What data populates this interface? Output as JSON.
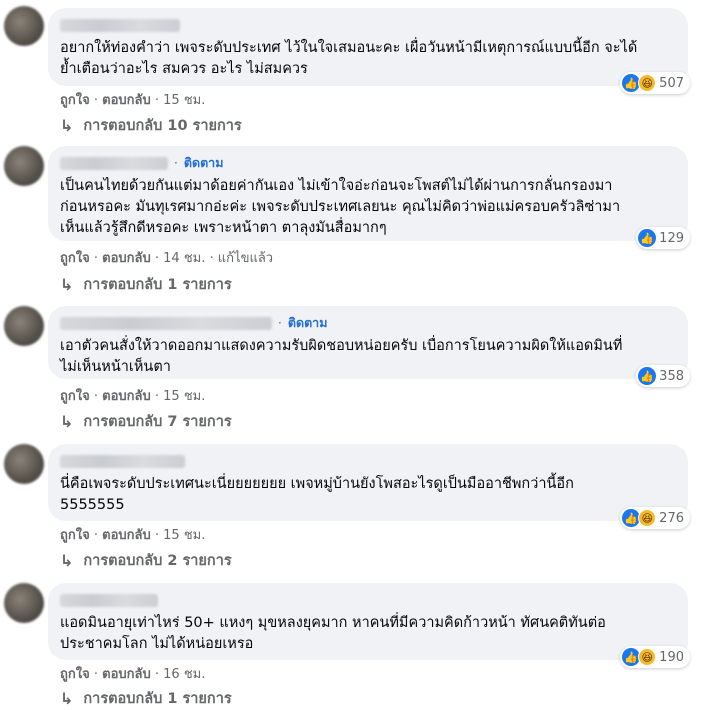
{
  "comments": [
    {
      "follow": "",
      "text": "อยากให้ท่องคำว่า เพจระดับประเทศ ไว้ในใจเสมอนะคะ เผื่อวันหน้ามีเหตุการณ์แบบนี้อีก จะได้\nย้ำเตือนว่าอะไร สมควร อะไร ไม่สมควร",
      "like": "ถูกใจ",
      "reply": "ตอบกลับ",
      "time": "15 ชม.",
      "edited": "",
      "reaction_count": "507",
      "reactions": [
        "like-icon",
        "haha-icon"
      ],
      "replies_label": "การตอบกลับ 10 รายการ"
    },
    {
      "follow": "ติดตาม",
      "text": "เป็นคนไทยด้วยกันแต่มาด้อยค่ากันเอง ไม่เข้าใจอ่ะก่อนจะโพสต์ไม่ได้ผ่านการกลั่นกรองมา\nก่อนหรอคะ มันทุเรศมากอ่ะค่ะ เพจระดับประเทศเลยนะ คุณไม่คิดว่าพ่อแม่ครอบครัวลิซ่ามา\nเห็นแล้วรู้สึกดีหรอคะ เพราะหน้าตา ตาลุงมันสื่อมากๆ",
      "like": "ถูกใจ",
      "reply": "ตอบกลับ",
      "time": "14 ชม.",
      "edited": "แก้ไขแล้ว",
      "reaction_count": "129",
      "reactions": [
        "like-icon"
      ],
      "replies_label": "การตอบกลับ 1 รายการ"
    },
    {
      "follow": "ติดตาม",
      "text": "เอาตัวคนสั่งให้วาดออกมาแสดงความรับผิดชอบหน่อยครับ เบื่อการโยนความผิดให้แอดมินที่\nไม่เห็นหน้าเห็นตา",
      "like": "ถูกใจ",
      "reply": "ตอบกลับ",
      "time": "15 ชม.",
      "edited": "",
      "reaction_count": "358",
      "reactions": [
        "like-icon"
      ],
      "replies_label": "การตอบกลับ 7 รายการ"
    },
    {
      "follow": "",
      "text": "นี่คือเพจระดับประเทศนะเนี่ยยยยยยย เพจหมู่บ้านยังโพสอะไรดูเป็นมืออาชีพกว่านี้อีก\n5555555",
      "like": "ถูกใจ",
      "reply": "ตอบกลับ",
      "time": "15 ชม.",
      "edited": "",
      "reaction_count": "276",
      "reactions": [
        "like-icon",
        "haha-icon"
      ],
      "replies_label": "การตอบกลับ 2 รายการ"
    },
    {
      "follow": "",
      "text": "แอดมินอายุเท่าไหร่ 50+ แหงๆ มุขหลงยุคมาก หาคนที่มีความคิดก้าวหน้า ทัศนคติทันต่อ\nประชาคมโลก ไม่ได้หน่อยเหรอ",
      "like": "ถูกใจ",
      "reply": "ตอบกลับ",
      "time": "16 ชม.",
      "edited": "",
      "reaction_count": "190",
      "reactions": [
        "like-icon",
        "haha-icon"
      ],
      "replies_label": "การตอบกลับ 1 รายการ"
    }
  ],
  "separator": "·",
  "colors": {
    "bubble": "#f0f2f5",
    "meta": "#65676b",
    "link": "#216fdb",
    "like": "#1877f2",
    "haha": "#f7b928"
  }
}
